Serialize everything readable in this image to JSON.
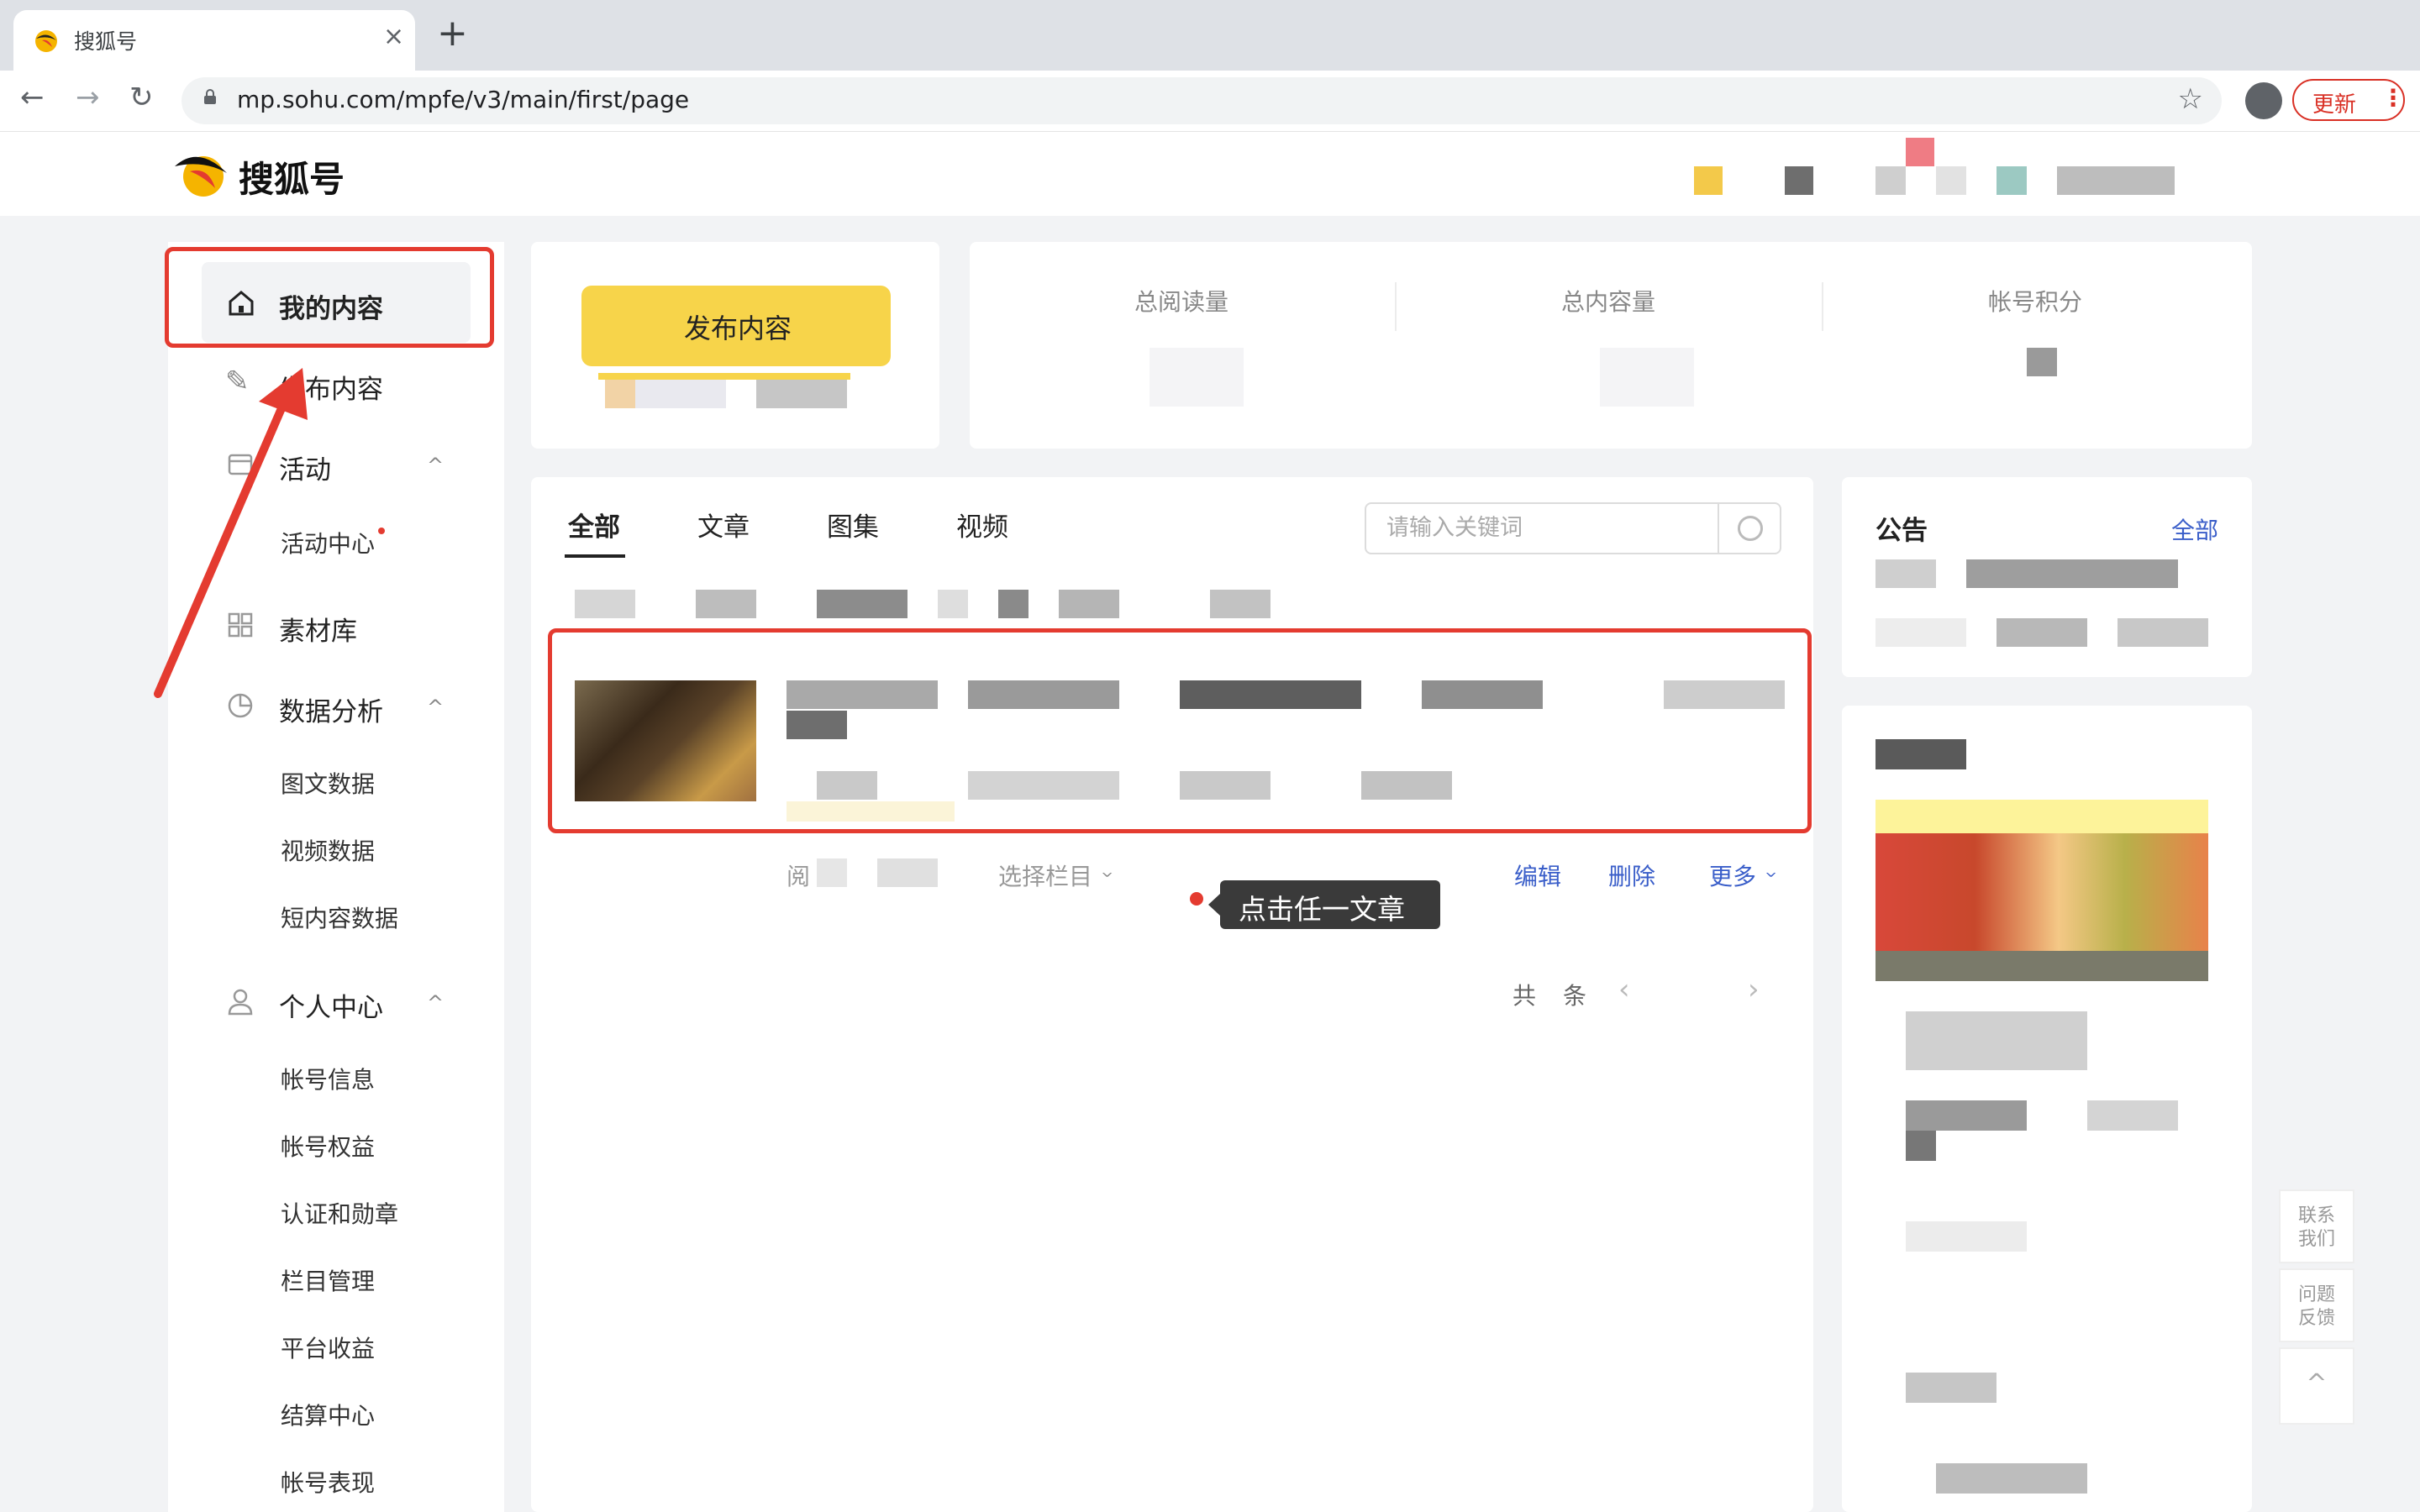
{
  "browser": {
    "tab_title": "搜狐号",
    "tab_close": "×",
    "new_tab": "+",
    "back": "←",
    "forward": "→",
    "reload": "↻",
    "url": "mp.sohu.com/mpfe/v3/main/first/page",
    "bookmark": "☆",
    "update_label": "更新",
    "menu_dots": "⋮"
  },
  "site": {
    "logo_text": "搜狐号"
  },
  "sidebar": {
    "my_content": "我的内容",
    "publish": "发布内容",
    "activities": "活动",
    "activity_center": "活动中心",
    "materials": "素材库",
    "data_analysis": "数据分析",
    "article_data": "图文数据",
    "video_data": "视频数据",
    "short_data": "短内容数据",
    "personal": "个人中心",
    "account_info": "帐号信息",
    "account_rights": "帐号权益",
    "certification": "认证和勋章",
    "column_manage": "栏目管理",
    "platform_income": "平台收益",
    "settlement": "结算中心",
    "account_perf": "帐号表现",
    "chevron": "^"
  },
  "top": {
    "publish_button": "发布内容",
    "total_reads": "总阅读量",
    "total_content": "总内容量",
    "account_points": "帐号积分"
  },
  "content": {
    "tabs": [
      "全部",
      "文章",
      "图集",
      "视频"
    ],
    "search_placeholder": "请输入关键词",
    "read_label": "阅",
    "select_column": "选择栏目",
    "edit": "编辑",
    "delete": "删除",
    "more": "更多",
    "tooltip": "点击任一文章",
    "pager_total_prefix": "共",
    "pager_total_suffix": "条",
    "pager_prev": "‹",
    "pager_next": "›"
  },
  "notice": {
    "title": "公告",
    "all": "全部"
  },
  "float": {
    "contact": "联系\n我们",
    "feedback": "问题\n反馈",
    "top": "^"
  },
  "colors": {
    "accent_yellow": "#f7d44a",
    "link_blue": "#3a5ec9",
    "annotation_red": "#e43b30"
  }
}
